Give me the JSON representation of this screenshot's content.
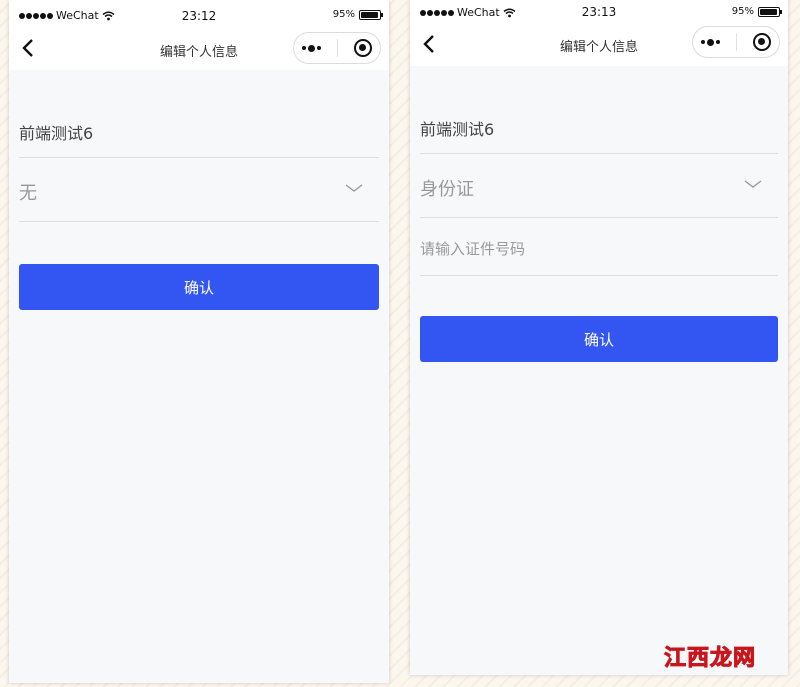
{
  "left": {
    "status": {
      "carrier": "WeChat",
      "time": "23:12",
      "battery": "95%"
    },
    "nav": {
      "title": "编辑个人信息"
    },
    "form": {
      "name": "前端测试6",
      "id_type": "无"
    },
    "confirm_label": "确认"
  },
  "right": {
    "status": {
      "carrier": "WeChat",
      "time": "23:13",
      "battery": "95%"
    },
    "nav": {
      "title": "编辑个人信息"
    },
    "form": {
      "name": "前端测试6",
      "id_type": "身份证",
      "id_placeholder": "请输入证件号码"
    },
    "confirm_label": "确认"
  },
  "watermark": "江西龙网",
  "colors": {
    "accent": "#3355f2",
    "watermark": "#c8161d"
  }
}
